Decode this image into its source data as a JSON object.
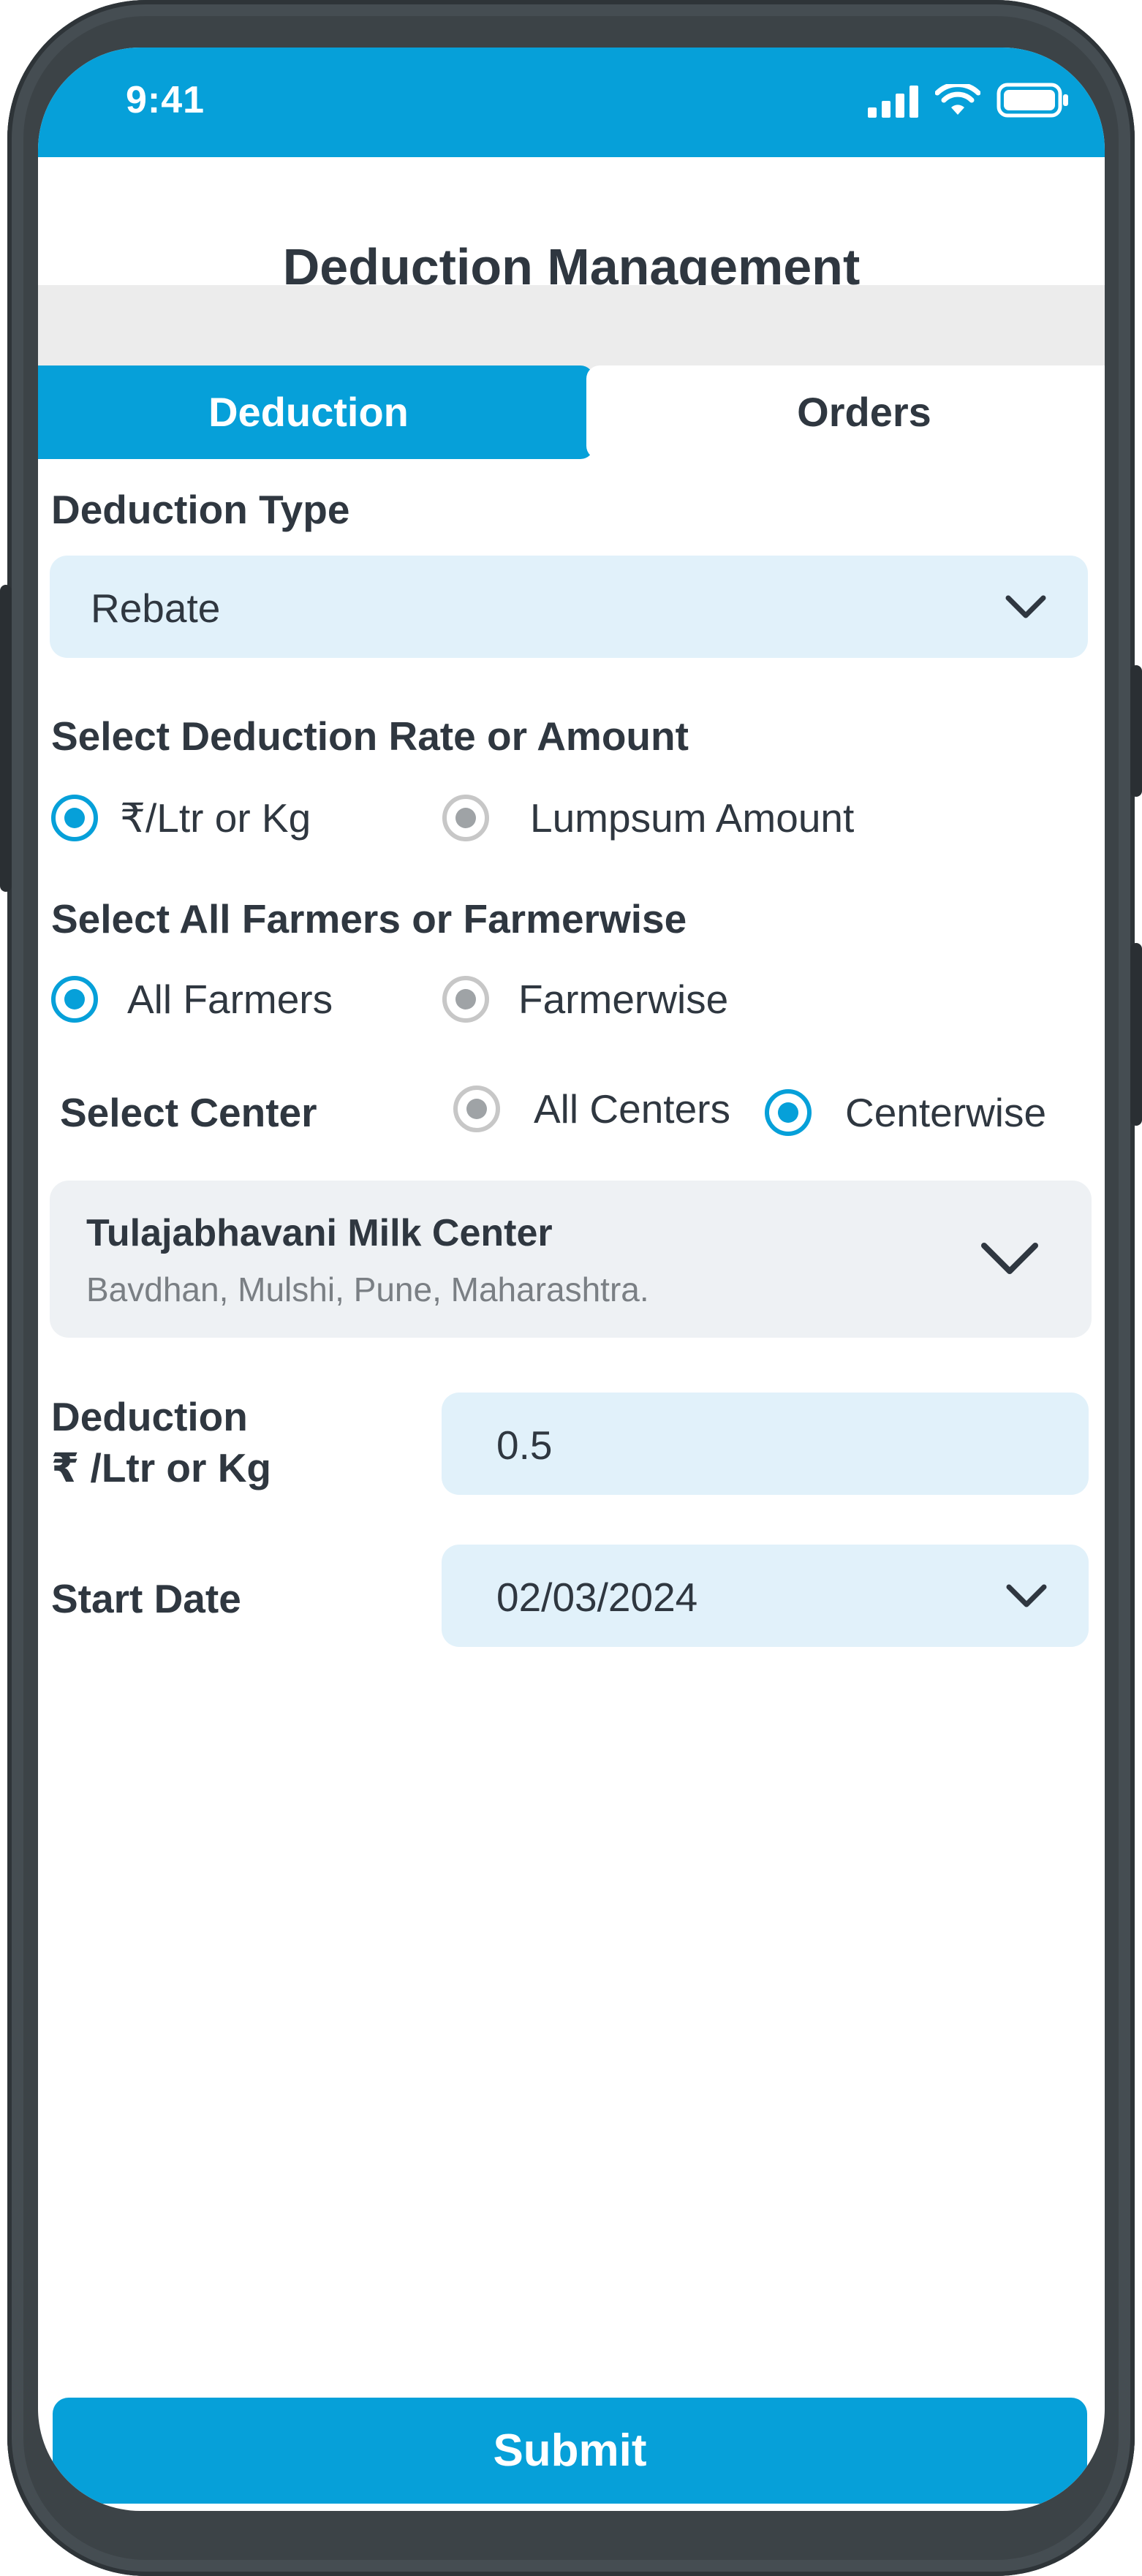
{
  "status_bar": {
    "time": "9:41"
  },
  "header": {
    "title": "Deduction Management"
  },
  "tabs": [
    {
      "label": "Deduction",
      "active": true
    },
    {
      "label": "Orders",
      "active": false
    }
  ],
  "deduction_type": {
    "label": "Deduction Type",
    "value": "Rebate"
  },
  "rate_or_amount": {
    "label": "Select Deduction Rate or Amount",
    "options": [
      {
        "label": "₹/Ltr or Kg",
        "selected": true
      },
      {
        "label": "Lumpsum Amount",
        "selected": false
      }
    ]
  },
  "farmers": {
    "label": "Select All Farmers or Farmerwise",
    "options": [
      {
        "label": "All Farmers",
        "selected": true
      },
      {
        "label": "Farmerwise",
        "selected": false
      }
    ]
  },
  "center": {
    "label": "Select Center",
    "options": [
      {
        "label": "All Centers",
        "selected": false
      },
      {
        "label": "Centerwise",
        "selected": true
      }
    ],
    "selected_center": {
      "name": "Tulajabhavani Milk Center",
      "address": "Bavdhan, Mulshi, Pune, Maharashtra."
    }
  },
  "deduction_rate": {
    "label_line1": "Deduction",
    "label_line2": "₹ /Ltr or Kg",
    "value": "0.5"
  },
  "start_date": {
    "label": "Start Date",
    "value": "02/03/2024"
  },
  "submit": {
    "label": "Submit"
  },
  "colors": {
    "accent": "#06a0d9",
    "field_bg": "#e1f1fa",
    "text": "#2f3740"
  }
}
